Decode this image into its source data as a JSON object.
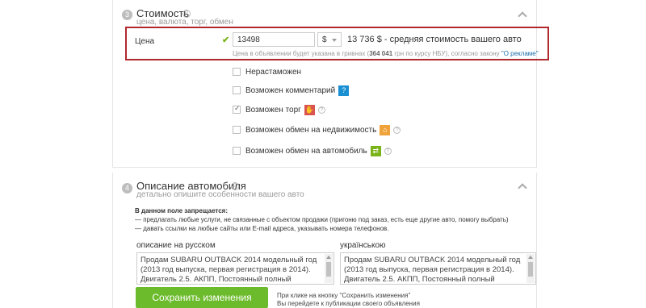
{
  "section3": {
    "number": "3",
    "title": "Стоимость",
    "subtitle": "цена, валюта, торг, обмен"
  },
  "price": {
    "label": "Цена",
    "value": "13498",
    "currency": "$",
    "average_text": "13 736 $ - средняя стоимость вашего авто",
    "note_prefix": "Цена в объявлении будет указана в гривнах (",
    "note_uah": "364 041",
    "note_mid": " грн по курсу НБУ), согласно закону ",
    "note_link": "\"О рекламе\""
  },
  "options": [
    {
      "label": "Нерастаможен",
      "checked": false
    },
    {
      "label": "Возможен комментарий",
      "checked": false,
      "badge": "?"
    },
    {
      "label": "Возможен торг",
      "checked": true,
      "badge": "✋"
    },
    {
      "label": "Возможен обмен на недвижимость",
      "checked": false,
      "badge": "⌂"
    },
    {
      "label": "Возможен обмен на автомобиль",
      "checked": false,
      "badge": "⇄"
    }
  ],
  "section4": {
    "number": "4",
    "title": "Описание автомобиля",
    "subtitle": "детально опишите особенности вашего авто"
  },
  "warning": {
    "title": "В данном поле запрещается:",
    "line1": "— предлагать любые услуги, не связанные с объектом продажи (пригоню под заказ, есть еще другие авто, помогу выбрать)",
    "line2": "— давать ссылки на любые сайты или E-mail адреса, указывать номера телефонов."
  },
  "desc_ru": {
    "title": "описание на русском",
    "text": "Продам SUBARU OUTBACK 2014 модельный год (2013 год выпуска, первая регистрация в 2014). Двигатель 2.5. АКПП, Постоянный полный привод. Комфортный, надежный"
  },
  "desc_ua": {
    "title": "українською",
    "text": "Продам SUBARU OUTBACK 2014 модельный год (2013 год выпуска, первая регистрация в 2014). Двигатель 2.5. АКПП, Постоянный полный привод. Комфортный,"
  },
  "save": {
    "button": "Сохранить изменения",
    "note1": "При клике на кнопку \"Сохранить изменения\"",
    "note2": "Вы перейдете к публикации своего объявления"
  }
}
